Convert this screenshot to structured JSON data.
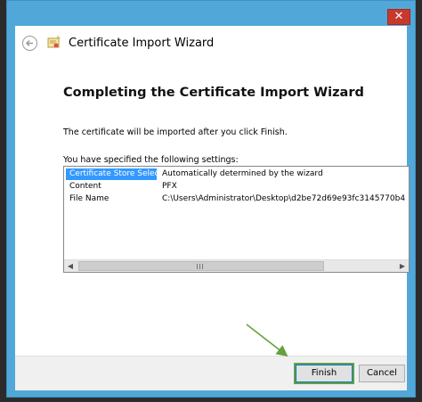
{
  "window": {
    "title": "Certificate Import Wizard",
    "close_glyph": "✕"
  },
  "page": {
    "heading": "Completing the Certificate Import Wizard",
    "info": "The certificate will be imported after you click Finish.",
    "settings_label": "You have specified the following settings:"
  },
  "settings": [
    {
      "key": "Certificate Store Selected",
      "value": "Automatically determined by the wizard",
      "selected": true
    },
    {
      "key": "Content",
      "value": "PFX",
      "selected": false
    },
    {
      "key": "File Name",
      "value": "C:\\Users\\Administrator\\Desktop\\d2be72d69e93fc3145770b4",
      "selected": false
    }
  ],
  "scrollbar": {
    "left_glyph": "◀",
    "right_glyph": "▶"
  },
  "buttons": {
    "finish": "Finish",
    "cancel": "Cancel"
  },
  "colors": {
    "title_bar": "#52a7d9",
    "selection": "#3399ff",
    "annotation": "#66a03f"
  }
}
